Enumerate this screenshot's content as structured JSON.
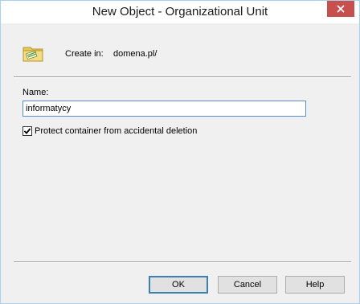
{
  "window": {
    "title": "New Object - Organizational Unit"
  },
  "header": {
    "create_in_label": "Create in:",
    "create_in_value": "domena.pl/"
  },
  "form": {
    "name_label": "Name:",
    "name_value": "informatycy",
    "protect_label": "Protect container from accidental deletion",
    "protect_checked": true
  },
  "buttons": {
    "ok": "OK",
    "cancel": "Cancel",
    "help": "Help"
  },
  "colors": {
    "close_button": "#c7504f",
    "focus_border": "#5a8fcf",
    "default_button_border": "#3c7fb1"
  }
}
